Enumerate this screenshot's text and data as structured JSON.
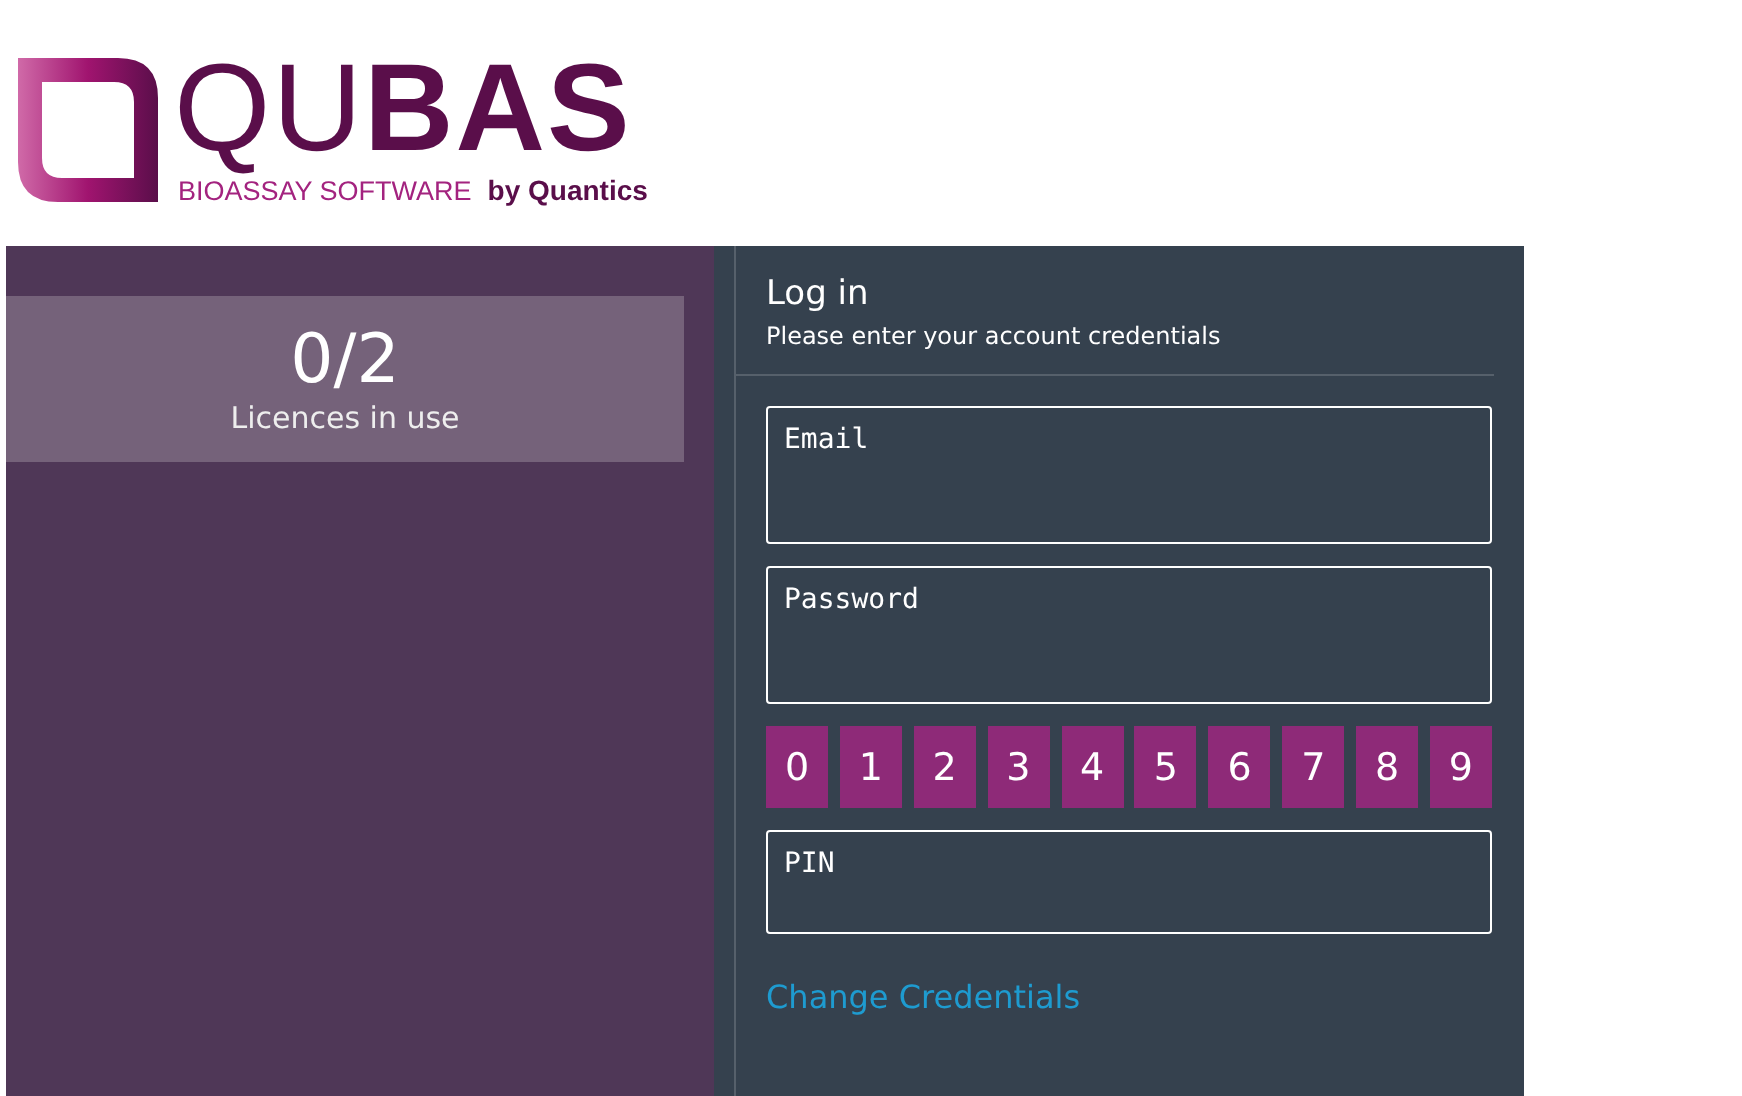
{
  "logo": {
    "name": "QU**BAS**",
    "tagline": "BIOASSAY SOFTWARE",
    "byline": "by Quantics"
  },
  "licences": {
    "count": "0/2",
    "label": "Licences in use"
  },
  "login": {
    "title": "Log in",
    "subtitle": "Please enter your account credentials",
    "email": {
      "placeholder": "Email"
    },
    "password": {
      "placeholder": "Password"
    },
    "keypad": [
      "0",
      "1",
      "2",
      "3",
      "4",
      "5",
      "6",
      "7",
      "8",
      "9"
    ],
    "pin": {
      "placeholder": "PIN"
    },
    "link": "Change Credentials"
  }
}
